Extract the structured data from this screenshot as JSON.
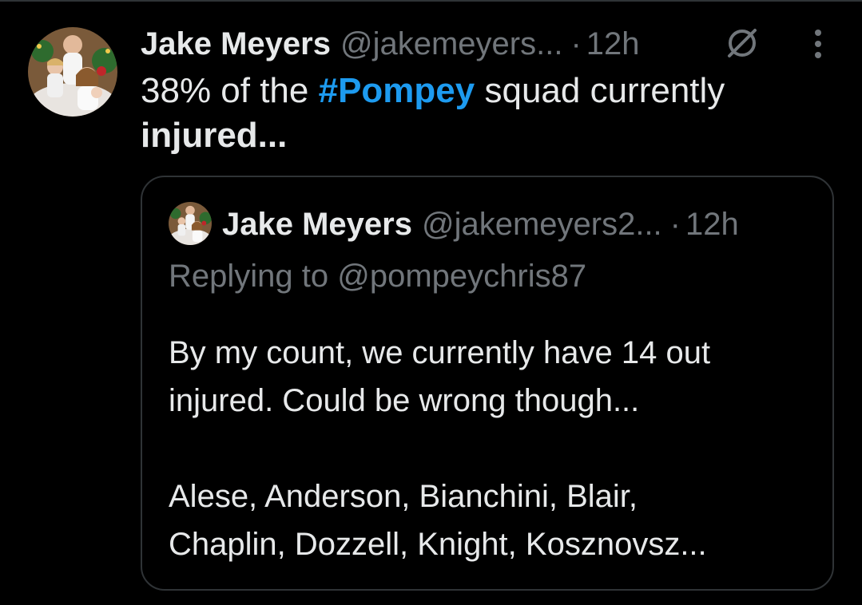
{
  "tweet": {
    "author_name": "Jake Meyers",
    "author_handle": "@jakemeyers...",
    "separator": "·",
    "time": "12h",
    "text_part1": "38% of the ",
    "hashtag": "#Pompey",
    "text_part2": " squad currently",
    "text_part3": "injured...",
    "icons": {
      "grok": "grok-icon",
      "more": "more-vertical-icon",
      "avatar": "avatar"
    }
  },
  "quoted_tweet": {
    "author_name": "Jake Meyers",
    "author_handle": "@jakemeyers2...",
    "separator": "·",
    "time": "12h",
    "replying_prefix": "Replying to ",
    "replying_to": "@pompeychris87",
    "line1": "By my count, we currently have 14 out",
    "line2": "injured. Could be wrong though...",
    "line3": "Alese, Anderson, Bianchini, Blair,",
    "line4": "Chaplin, Dozzell, Knight, Kosznovsz..."
  },
  "colors": {
    "background": "#000000",
    "text": "#e7e9ea",
    "secondary": "#71767b",
    "accent": "#1d9bf0",
    "border": "#2f3336"
  }
}
